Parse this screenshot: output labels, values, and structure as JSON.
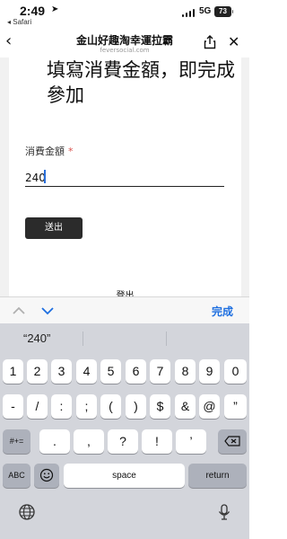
{
  "status_bar": {
    "time": "2:49",
    "back_app": "◂ Safari",
    "network": "5G",
    "battery": "73"
  },
  "nav": {
    "title": "金山好趣淘幸運拉霸",
    "subtitle": "feversocial.com"
  },
  "form": {
    "heading": "填寫消費金額，即完成參加",
    "field_label": "消費金額",
    "required_mark": "*",
    "amount_value": "240",
    "submit_label": "送出",
    "logout_label": "登出"
  },
  "accessory_bar": {
    "done_label": "完成"
  },
  "keyboard": {
    "suggestion": "“240”",
    "row1": [
      "1",
      "2",
      "3",
      "4",
      "5",
      "6",
      "7",
      "8",
      "9",
      "0"
    ],
    "row2": [
      "-",
      "/",
      ":",
      ";",
      "(",
      ")",
      "$",
      "&",
      "@",
      "”"
    ],
    "row3_left": "#+=",
    "row3": [
      ".",
      ",",
      "?",
      "!",
      "’"
    ],
    "row4_left": "ABC",
    "space_label": "space",
    "return_label": "return"
  },
  "icons": [
    "location-arrow-icon",
    "signal-icon",
    "battery-icon",
    "back-chevron-icon",
    "share-icon",
    "close-icon",
    "chevron-up-icon",
    "chevron-down-icon",
    "emoji-icon",
    "delete-icon",
    "globe-icon",
    "mic-icon"
  ],
  "colors": {
    "accent": "#1e6fe0",
    "button": "#2b2b2b",
    "required": "#d9534f",
    "keyboard_bg": "#d3d5db"
  }
}
